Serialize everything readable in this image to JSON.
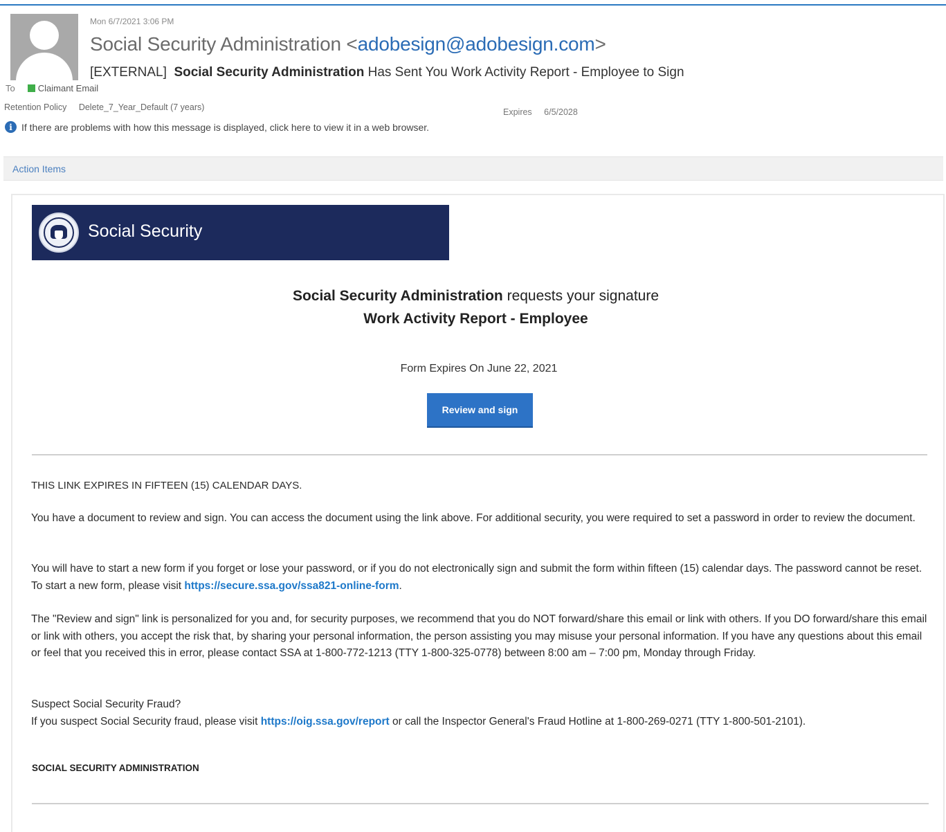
{
  "header": {
    "sent_date": "Mon 6/7/2021 3:06 PM",
    "sender_name": "Social Security Administration",
    "sender_email": "adobesign@adobesign.com",
    "subject_tag": "[EXTERNAL]",
    "subject_bold": "Social Security Administration",
    "subject_rest": "Has Sent You Work Activity Report - Employee to Sign",
    "to_label": "To",
    "recipient": "Claimant Email",
    "retention_label": "Retention Policy",
    "retention_value": "Delete_7_Year_Default (7 years)",
    "expires_label": "Expires",
    "expires_value": "6/5/2028",
    "info_text": "If there are problems with how this message is displayed, click here to view it in a web browser.",
    "action_items": "Action Items"
  },
  "banner": {
    "title": "Social Security"
  },
  "request": {
    "requester": "Social Security Administration",
    "requests_text": "requests your signature",
    "document_title": "Work Activity Report - Employee",
    "expires_on": "Form Expires On June 22, 2021",
    "button_label": "Review and sign"
  },
  "body": {
    "caps_notice": "THIS LINK EXPIRES IN FIFTEEN (15) CALENDAR DAYS.",
    "p1": "You have a document to review and sign. You can access the document using the link above. For additional security, you were required to set a password in order to review the document.",
    "p2_pre": "You will have to start a new form if you forget or lose your password, or if you do not electronically sign and submit the form within fifteen (15) calendar days. The password cannot be reset. To start a new form, please visit",
    "p2_link": "https://secure.ssa.gov/ssa821-online-form",
    "p2_post": ".",
    "p3": "The \"Review and sign\" link is personalized for you and, for security purposes, we recommend that you do NOT forward/share this email or link with others. If you DO forward/share this email or link with others, you accept the risk that, by sharing your personal information, the person assisting you may misuse your personal information. If you have any questions about this email or feel that you received this in error, please contact SSA at 1-800-772-1213 (TTY 1-800-325-0778) between 8:00 am – 7:00 pm, Monday through Friday.",
    "p4_heading": "Suspect Social Security Fraud?",
    "p4_pre": "If you suspect Social Security fraud, please visit",
    "p4_link": "https://oig.ssa.gov/report",
    "p4_post": "or call the Inspector General's Fraud Hotline at 1-800-269-0271 (TTY 1-800-501-2101).",
    "signature": "SOCIAL SECURITY ADMINISTRATION"
  },
  "colors": {
    "banner_bg": "#1c2a5c",
    "button_bg": "#2d73c6",
    "link": "#1d78c9",
    "presence": "#3fae49"
  }
}
